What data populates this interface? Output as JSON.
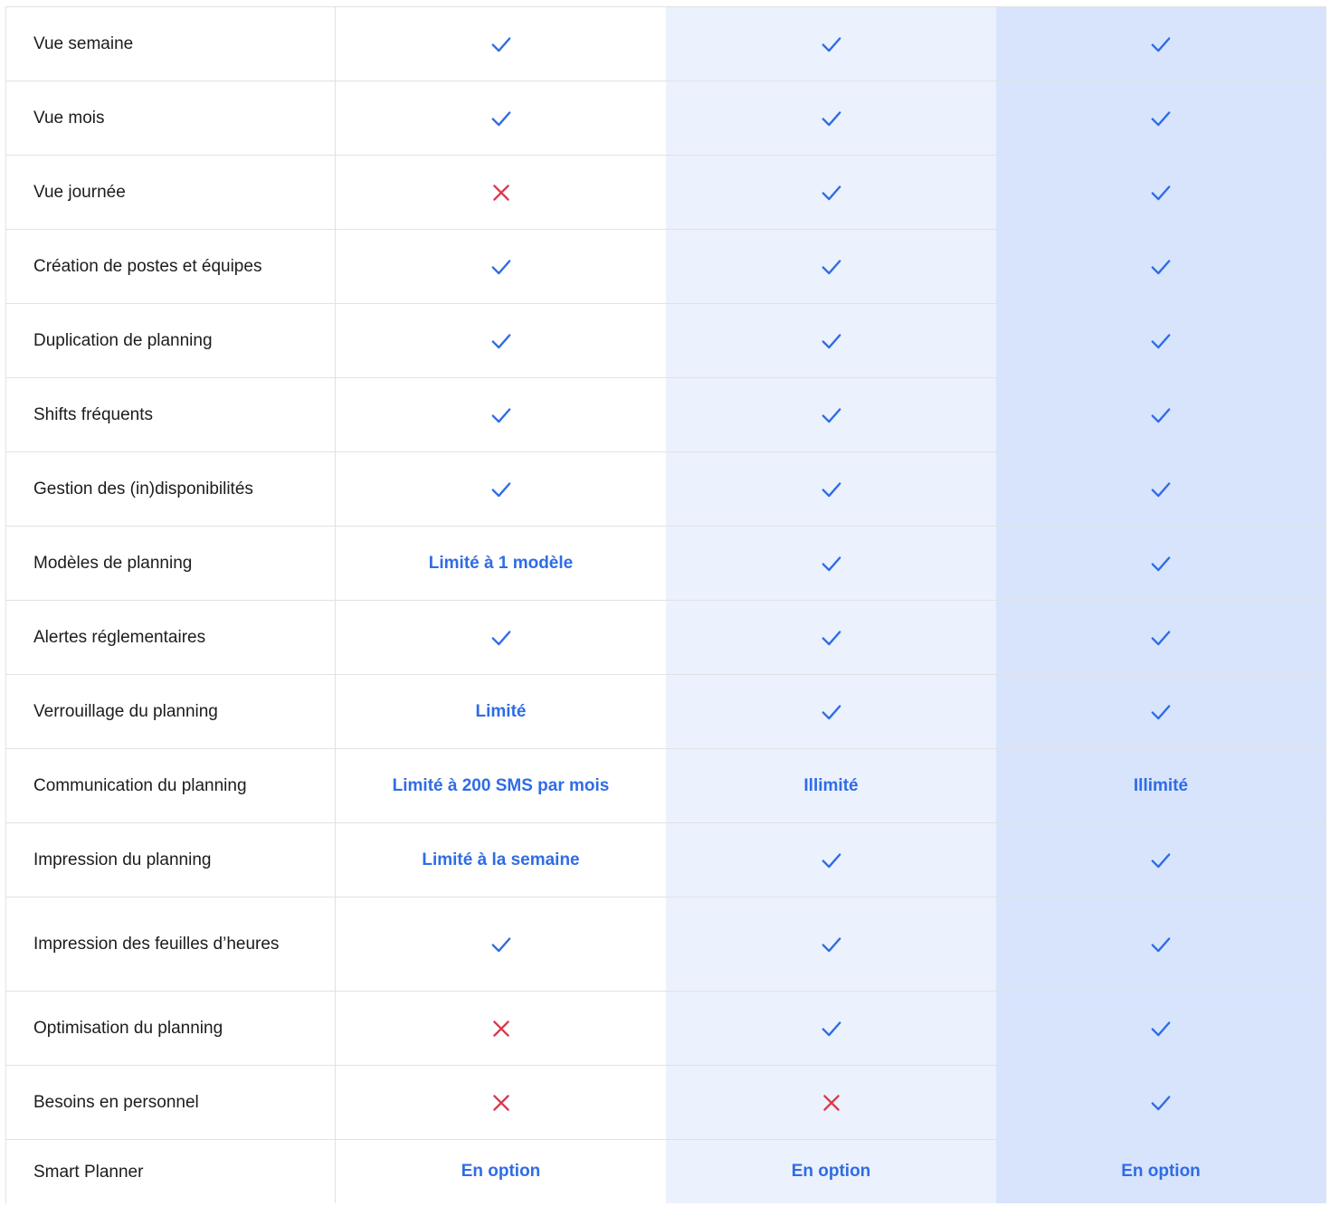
{
  "colors": {
    "accent": "#2f6ce5",
    "cross": "#d9394e",
    "column1_bg": "#ffffff",
    "column2_bg": "#ebf1fd",
    "column3_bg": "#d7e4fc"
  },
  "rows": [
    {
      "feature": "Vue semaine",
      "plans": [
        {
          "t": "check"
        },
        {
          "t": "check"
        },
        {
          "t": "check"
        }
      ]
    },
    {
      "feature": "Vue mois",
      "plans": [
        {
          "t": "check"
        },
        {
          "t": "check"
        },
        {
          "t": "check"
        }
      ]
    },
    {
      "feature": "Vue journée",
      "plans": [
        {
          "t": "cross"
        },
        {
          "t": "check"
        },
        {
          "t": "check"
        }
      ]
    },
    {
      "feature": "Création de postes et équipes",
      "plans": [
        {
          "t": "check"
        },
        {
          "t": "check"
        },
        {
          "t": "check"
        }
      ]
    },
    {
      "feature": "Duplication de planning",
      "plans": [
        {
          "t": "check"
        },
        {
          "t": "check"
        },
        {
          "t": "check"
        }
      ]
    },
    {
      "feature": "Shifts fréquents",
      "plans": [
        {
          "t": "check"
        },
        {
          "t": "check"
        },
        {
          "t": "check"
        }
      ]
    },
    {
      "feature": "Gestion des (in)disponibilités",
      "plans": [
        {
          "t": "check"
        },
        {
          "t": "check"
        },
        {
          "t": "check"
        }
      ]
    },
    {
      "feature": "Modèles de planning",
      "plans": [
        {
          "t": "text",
          "v": "Limité à 1 modèle"
        },
        {
          "t": "check"
        },
        {
          "t": "check"
        }
      ]
    },
    {
      "feature": "Alertes réglementaires",
      "plans": [
        {
          "t": "check"
        },
        {
          "t": "check"
        },
        {
          "t": "check"
        }
      ]
    },
    {
      "feature": "Verrouillage du planning",
      "plans": [
        {
          "t": "text",
          "v": "Limité"
        },
        {
          "t": "check"
        },
        {
          "t": "check"
        }
      ]
    },
    {
      "feature": "Communication du planning",
      "plans": [
        {
          "t": "text",
          "v": "Limité à 200 SMS par mois"
        },
        {
          "t": "text",
          "v": "Illimité"
        },
        {
          "t": "text",
          "v": "Illimité"
        }
      ]
    },
    {
      "feature": "Impression du planning",
      "plans": [
        {
          "t": "text",
          "v": "Limité à la semaine"
        },
        {
          "t": "check"
        },
        {
          "t": "check"
        }
      ]
    },
    {
      "feature": "Impression des feuilles d’heures",
      "plans": [
        {
          "t": "check"
        },
        {
          "t": "check"
        },
        {
          "t": "check"
        }
      ]
    },
    {
      "feature": "Optimisation du planning",
      "plans": [
        {
          "t": "cross"
        },
        {
          "t": "check"
        },
        {
          "t": "check"
        }
      ]
    },
    {
      "feature": "Besoins en personnel",
      "plans": [
        {
          "t": "cross"
        },
        {
          "t": "cross"
        },
        {
          "t": "check"
        }
      ]
    },
    {
      "feature": "Smart Planner",
      "plans": [
        {
          "t": "text",
          "v": "En option"
        },
        {
          "t": "text",
          "v": "En option"
        },
        {
          "t": "text",
          "v": "En option"
        }
      ]
    }
  ]
}
